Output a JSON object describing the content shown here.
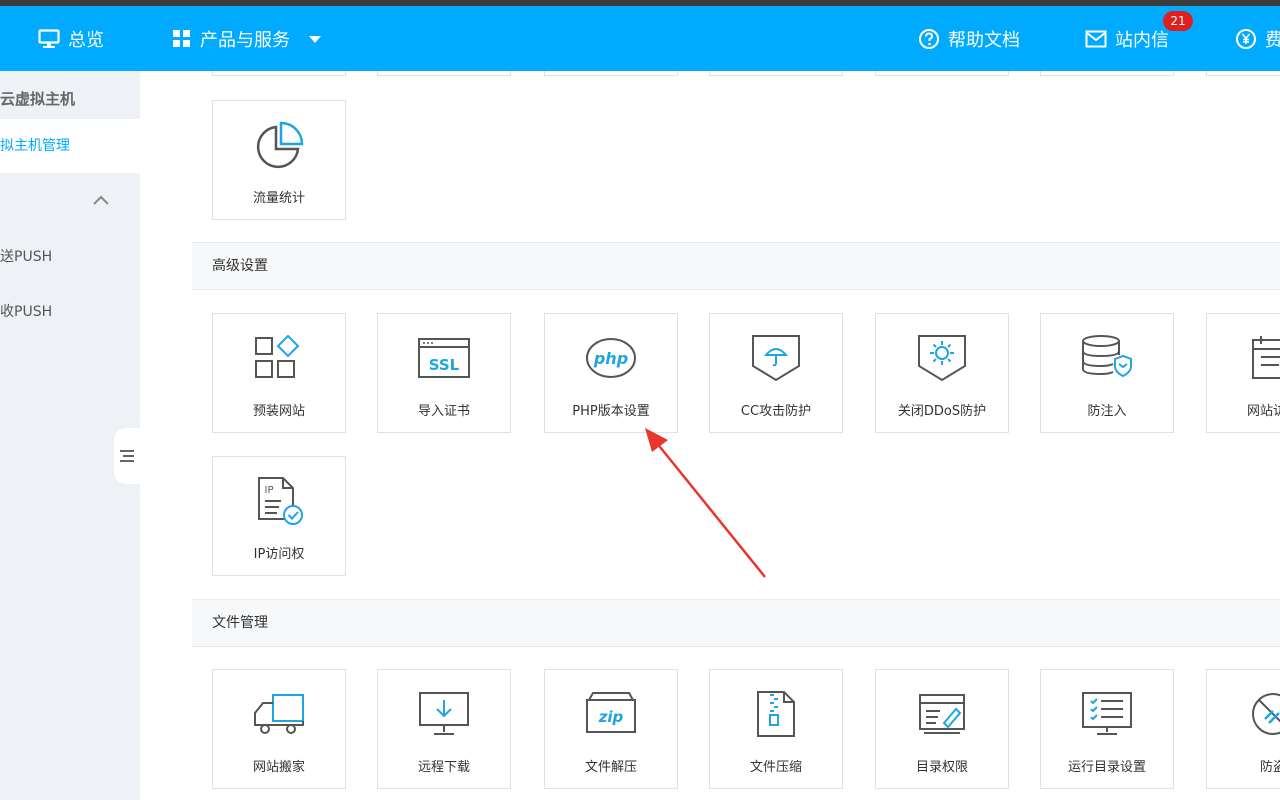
{
  "header": {
    "overview_label": "总览",
    "products_label": "产品与服务",
    "help_label": "帮助文档",
    "messages_label": "站内信",
    "messages_badge": "21",
    "fee_label": "费"
  },
  "sidebar": {
    "title": "云虚拟主机",
    "active_item": "拟主机管理",
    "items": [
      {
        "label": "送PUSH"
      },
      {
        "label": "收PUSH"
      }
    ]
  },
  "sections": {
    "advanced_title": "高级设置",
    "files_title": "文件管理"
  },
  "cards": {
    "traffic": "流量统计",
    "preinstall": "预装网站",
    "import_cert": "导入证书",
    "php_version": "PHP版本设置",
    "cc_protect": "CC攻击防护",
    "ddos_off": "关闭DDoS防护",
    "anti_inject": "防注入",
    "site_access": "网站访问",
    "ip_access": "IP访问权",
    "site_move": "网站搬家",
    "remote_download": "远程下载",
    "unzip": "文件解压",
    "zip": "文件压缩",
    "dir_perm": "目录权限",
    "run_dir": "运行目录设置",
    "anti_leech": "防盗"
  },
  "icon_text": {
    "ssl": "SSL",
    "php": "php",
    "zip": "zip",
    "ip": "IP"
  },
  "colors": {
    "brand": "#00aaff",
    "badge": "#e0201f",
    "arrow": "#e8362f",
    "icon_gray": "#555555"
  }
}
